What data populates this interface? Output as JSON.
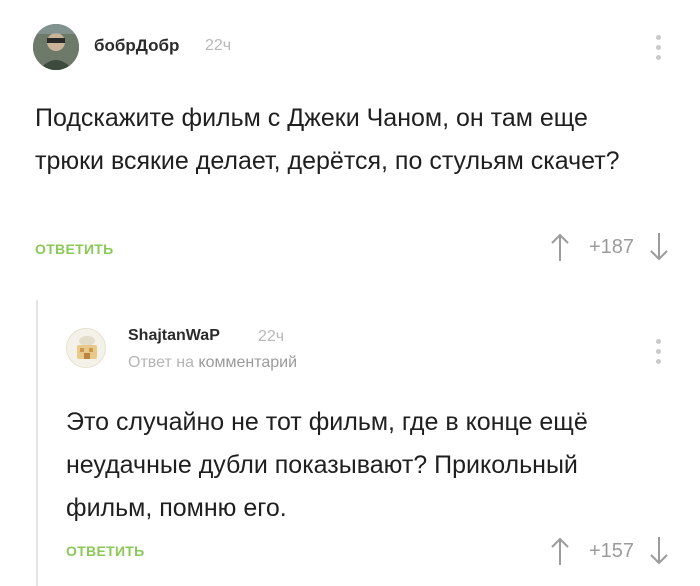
{
  "comments": [
    {
      "author": "бобрДобр",
      "time": "22ч",
      "text": "Подскажите фильм с Джеки Чаном, он там еще трюки всякие делает, дерётся, по стульям скачет?",
      "reply_label": "ОТВЕТИТЬ",
      "score": "+187"
    },
    {
      "author": "ShajtanWaP",
      "time": "22ч",
      "reply_prefix": "Ответ на",
      "reply_link": "комментарий",
      "text": "Это случайно не тот фильм, где в конце ещё неудачные дубли показывают? Прикольный фильм, помню его.",
      "reply_label": "ОТВЕТИТЬ",
      "score": "+157"
    }
  ],
  "colors": {
    "accent": "#8ac858",
    "muted": "#b8b8b8",
    "thread_line": "#e3e3e3"
  },
  "icons": [
    "upvote-arrow-icon",
    "downvote-arrow-icon",
    "more-options-icon"
  ]
}
